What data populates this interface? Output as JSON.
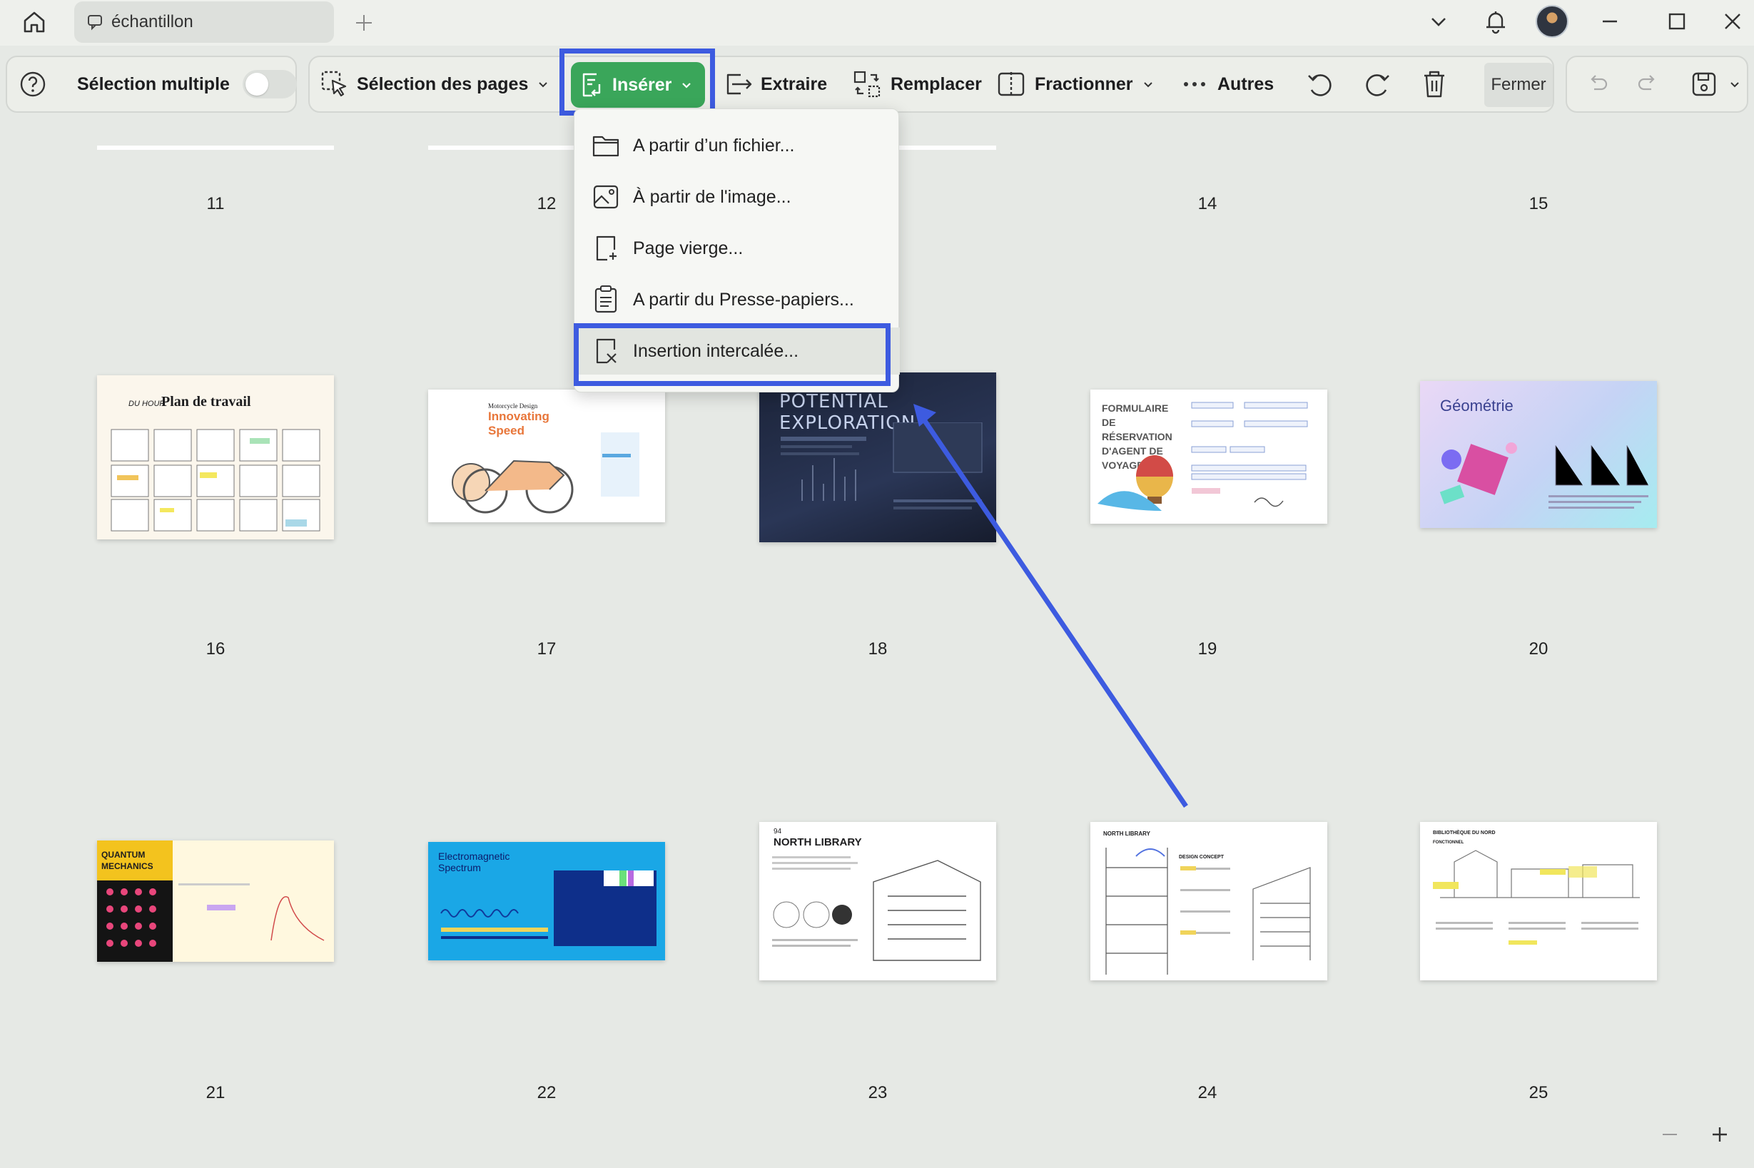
{
  "window": {
    "tab_title": "échantillon",
    "colors": {
      "accent": "#3aa65a",
      "highlight": "#3d5be0",
      "background": "#e6e9e5"
    }
  },
  "toolbar": {
    "multi_select_label": "Sélection multiple",
    "page_select_label": "Sélection des pages",
    "insert_label": "Insérer",
    "extract_label": "Extraire",
    "replace_label": "Remplacer",
    "split_label": "Fractionner",
    "more_label": "Autres",
    "close_label": "Fermer"
  },
  "insert_menu": {
    "items": [
      {
        "label": "A partir d’un fichier...",
        "icon": "folder-icon"
      },
      {
        "label": "À partir de l'image...",
        "icon": "image-icon"
      },
      {
        "label": "Page vierge...",
        "icon": "blank-page-icon"
      },
      {
        "label": "A partir du Presse-papiers...",
        "icon": "clipboard-icon"
      },
      {
        "label": "Insertion intercalée...",
        "icon": "interleave-icon"
      }
    ]
  },
  "pages": [
    {
      "number": "11"
    },
    {
      "number": "12"
    },
    {
      "number": "14"
    },
    {
      "number": "15"
    },
    {
      "number": "16",
      "title": "Plan de travail",
      "small": "DU HOUR"
    },
    {
      "number": "17",
      "title": "Innovating Speed",
      "small": "Motorcycle Design"
    },
    {
      "number": "18",
      "title": "POTENTIAL EXPLORATION"
    },
    {
      "number": "19",
      "title": "FORMULAIRE DE RÉSERVATION D'AGENT DE VOYAGE"
    },
    {
      "number": "20",
      "title": "Géométrie"
    },
    {
      "number": "21",
      "title": "QUANTUM MECHANICS"
    },
    {
      "number": "22",
      "title": "Electromagnetic Spectrum"
    },
    {
      "number": "23",
      "title": "NORTH LIBRARY",
      "small": "94"
    },
    {
      "number": "24",
      "title": "NORTH LIBRARY",
      "small": "DESIGN CONCEPT"
    },
    {
      "number": "25",
      "title": "BIBLIOTHÈQUE DU NORD",
      "small": "FONCTIONNEL"
    }
  ]
}
